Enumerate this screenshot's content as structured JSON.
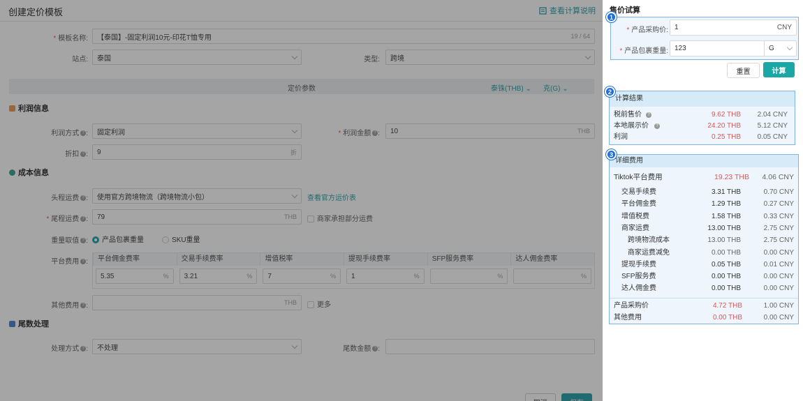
{
  "header": {
    "title": "创建定价模板",
    "help_link": "查看计算说明"
  },
  "form": {
    "template_name": {
      "label": "模板名称:",
      "value": "【泰国】-固定利润10元-印花T恤专用",
      "counter": "19 / 64"
    },
    "site": {
      "label": "站点:",
      "value": "泰国"
    },
    "type": {
      "label": "类型:",
      "value": "跨境"
    },
    "pricing_bar": {
      "title": "定价参数",
      "currency": "泰铢(THB)",
      "weight_unit": "克(G)"
    },
    "profit_section": {
      "title": "利润信息"
    },
    "profit_method": {
      "label": "利润方式",
      "value": "固定利润"
    },
    "profit_amount": {
      "label": "利润金额",
      "value": "10",
      "suffix": "THB"
    },
    "discount": {
      "label": "折扣",
      "value": "9",
      "suffix": "折"
    },
    "cost_section": {
      "title": "成本信息"
    },
    "first_freight": {
      "label": "头程运费",
      "value": "使用官方跨境物流（跨境物流小包）",
      "link": "查看官方运价表"
    },
    "last_freight": {
      "label": "尾程运费",
      "value": "79",
      "suffix": "THB",
      "checkbox": "商家承担部分运费"
    },
    "weight_basis": {
      "label": "重量取值",
      "option1": "产品包裹重量",
      "option2": "SKU重量"
    },
    "platform_fee": {
      "label": "平台费用",
      "columns": [
        {
          "header": "平台佣金费率",
          "value": "5.35",
          "unit": "%"
        },
        {
          "header": "交易手续费率",
          "value": "3.21",
          "unit": "%"
        },
        {
          "header": "增值税率",
          "value": "7",
          "unit": "%"
        },
        {
          "header": "提现手续费率",
          "value": "1",
          "unit": "%"
        },
        {
          "header": "SFP服务费率",
          "value": "",
          "unit": "%"
        },
        {
          "header": "达人佣金费率",
          "value": "",
          "unit": "%"
        }
      ]
    },
    "other_fee": {
      "label": "其他费用",
      "value": "",
      "suffix": "THB",
      "checkbox": "更多"
    },
    "rounding_section": {
      "title": "尾数处理"
    },
    "rounding_method": {
      "label": "处理方式",
      "value": "不处理"
    },
    "rounding_amount": {
      "label": "尾数金额",
      "value": ""
    },
    "footer": {
      "cancel": "取消",
      "save": "保存"
    }
  },
  "calc": {
    "title": "售价试算",
    "purchase_price": {
      "label": "产品采购价:",
      "value": "1",
      "suffix": "CNY"
    },
    "package_weight": {
      "label": "产品包裹重量:",
      "value": "123",
      "unit": "G"
    },
    "reset": "重置",
    "compute": "计算",
    "results": {
      "title": "计算结果",
      "rows": [
        {
          "label": "税前售价",
          "thb": "9.62 THB",
          "cny": "2.04 CNY"
        },
        {
          "label": "本地展示价",
          "thb": "24.20 THB",
          "cny": "5.12 CNY"
        },
        {
          "label": "利润",
          "thb": "0.25 THB",
          "cny": "0.05 CNY"
        }
      ]
    },
    "details": {
      "title": "详细费用",
      "tiktok": {
        "label": "Tiktok平台费用",
        "thb": "19.23 THB",
        "cny": "4.06 CNY"
      },
      "rows": [
        {
          "label": "交易手续费",
          "thb": "3.31 THB",
          "cny": "0.70 CNY"
        },
        {
          "label": "平台佣金费",
          "thb": "1.29 THB",
          "cny": "0.27 CNY"
        },
        {
          "label": "增值税费",
          "thb": "1.58 THB",
          "cny": "0.33 CNY"
        },
        {
          "label": "商家运费",
          "thb": "13.00 THB",
          "cny": "2.75 CNY"
        },
        {
          "label": "跨境物流成本",
          "thb": "13.00 THB",
          "cny": "2.75 CNY"
        },
        {
          "label": "商家运费减免",
          "thb": "0.00 THB",
          "cny": "0.00 CNY"
        },
        {
          "label": "提现手续费",
          "thb": "0.05 THB",
          "cny": "0.01 CNY"
        },
        {
          "label": "SFP服务费",
          "thb": "0.00 THB",
          "cny": "0.00 CNY"
        },
        {
          "label": "达人佣金费",
          "thb": "0.00 THB",
          "cny": "0.00 CNY"
        }
      ],
      "purchase": {
        "label": "产品采购价",
        "thb": "4.72 THB",
        "cny": "1.00 CNY"
      },
      "other": {
        "label": "其他费用",
        "thb": "0.00 THB",
        "cny": "0.00 CNY"
      }
    },
    "badges": [
      "1",
      "2",
      "3"
    ]
  },
  "colors": {
    "accent": "#1a9ba3",
    "highlight_border": "#7fb2ea",
    "badge": "#1f6fd9",
    "red": "#e05555"
  }
}
